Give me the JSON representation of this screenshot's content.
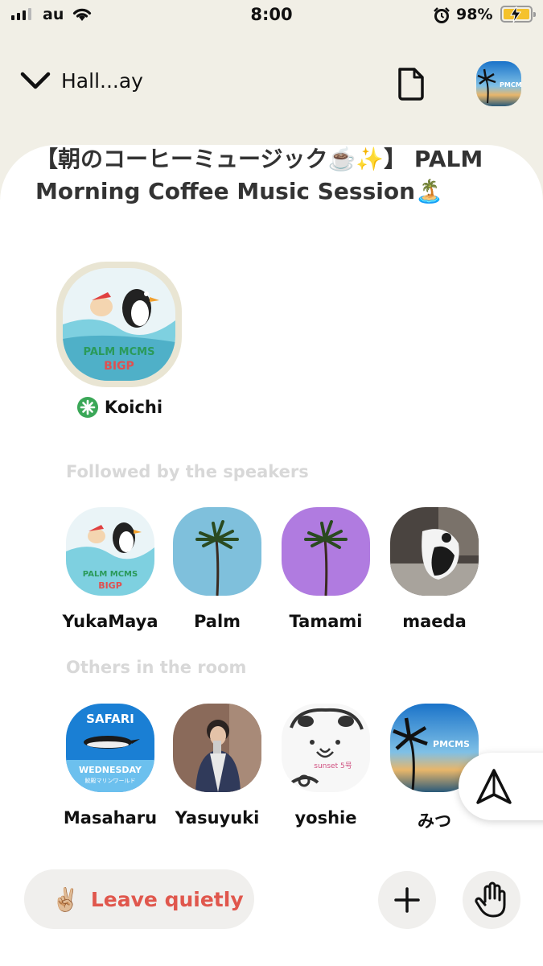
{
  "status_bar": {
    "carrier": "au",
    "time": "8:00",
    "battery_percent": "98%"
  },
  "nav": {
    "back_label": "Hall...ay"
  },
  "room": {
    "title": "【朝のコーヒーミュージック☕️✨】 PALM Morning Coffee Music Session🏝️"
  },
  "speakers": [
    {
      "name": "Koichi"
    }
  ],
  "followed_section": {
    "label": "Followed by the speakers",
    "users": [
      {
        "name": "YukaMaya"
      },
      {
        "name": "Palm"
      },
      {
        "name": "Tamami"
      },
      {
        "name": "maeda"
      }
    ]
  },
  "others_section": {
    "label": "Others in the room",
    "users": [
      {
        "name": "Masaharu"
      },
      {
        "name": "Yasuyuki"
      },
      {
        "name": "yoshie"
      },
      {
        "name": "みつ"
      }
    ]
  },
  "avatar_text": {
    "pmcms": "PMCMS",
    "safari": "SAFARI",
    "wednesday": "WEDNESDAY",
    "marine": "鮫殿マリンワールド",
    "bigp_top": "PALM MCMS",
    "bigp_bottom": "BIGP",
    "sunset": "sunset 5号"
  },
  "bottom_bar": {
    "leave_emoji": "✌🏼",
    "leave_label": "Leave quietly"
  },
  "colors": {
    "background": "#f1efe6",
    "card": "#ffffff",
    "leave_text": "#e0574d",
    "moderator_badge": "#3aa757",
    "palm_blue": "#7fc0dc",
    "palm_purple": "#b07be0"
  }
}
